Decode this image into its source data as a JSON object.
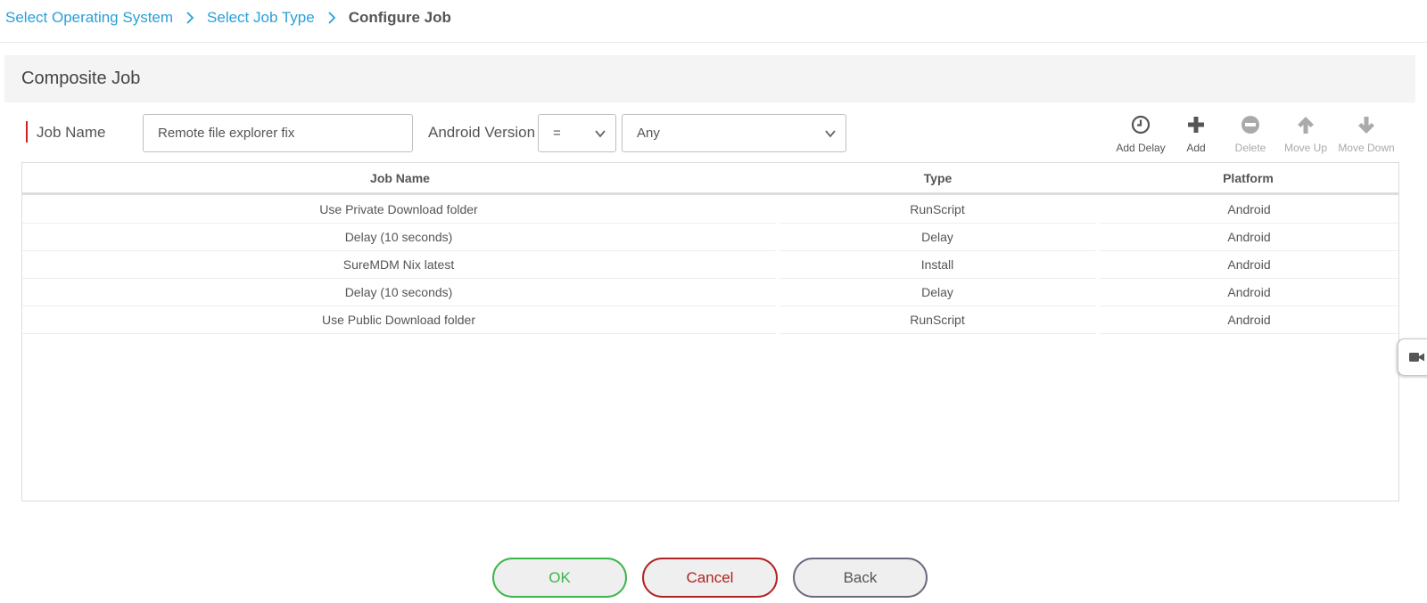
{
  "breadcrumb": {
    "items": [
      "Select Operating System",
      "Select Job Type"
    ],
    "current": "Configure Job"
  },
  "panel": {
    "title": "Composite Job"
  },
  "form": {
    "job_name_label": "Job Name",
    "job_name_value": "Remote file explorer fix",
    "android_version_label": "Android Version",
    "operator_value": "=",
    "version_value": "Any"
  },
  "toolbar": {
    "add_delay": "Add Delay",
    "add": "Add",
    "delete": "Delete",
    "move_up": "Move Up",
    "move_down": "Move Down"
  },
  "table": {
    "columns": [
      "Job Name",
      "Type",
      "Platform"
    ],
    "rows": [
      [
        "Use Private Download folder",
        "RunScript",
        "Android"
      ],
      [
        "Delay (10 seconds)",
        "Delay",
        "Android"
      ],
      [
        "SureMDM Nix latest",
        "Install",
        "Android"
      ],
      [
        "Delay (10 seconds)",
        "Delay",
        "Android"
      ],
      [
        "Use Public Download folder",
        "RunScript",
        "Android"
      ]
    ]
  },
  "side_tab": {
    "icon": "video-camera-icon"
  },
  "buttons": {
    "ok": "OK",
    "cancel": "Cancel",
    "back": "Back"
  },
  "colors": {
    "link": "#2a9fd8",
    "required": "#cc2222",
    "ok": "#3cb54a",
    "cancel": "#b22222",
    "back": "#6b6b80"
  }
}
